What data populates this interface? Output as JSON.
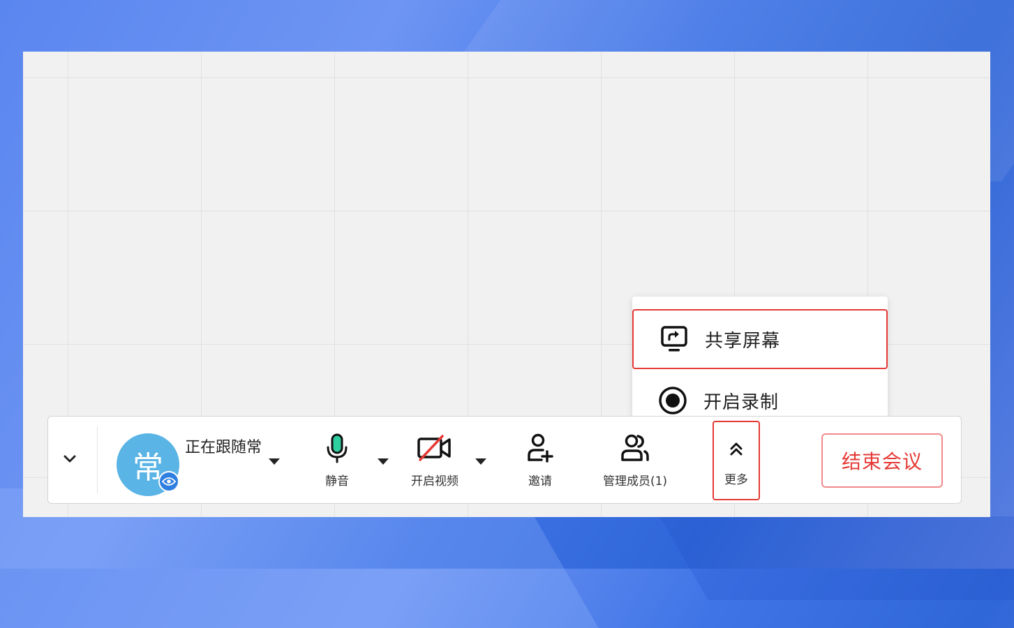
{
  "menu": {
    "share_screen": "共享屏幕",
    "start_recording": "开启录制"
  },
  "toolbar": {
    "avatar_char": "常",
    "follow_status": "正在跟随常",
    "mute": "静音",
    "video": "开启视频",
    "invite": "邀请",
    "members": "管理成员(1)",
    "more": "更多",
    "end_meeting": "结束会议"
  },
  "colors": {
    "accent_red": "#e53935",
    "avatar_bg": "#5ab4e5",
    "mic_green": "#2fd0a0",
    "badge_blue": "#2f7fe0"
  }
}
